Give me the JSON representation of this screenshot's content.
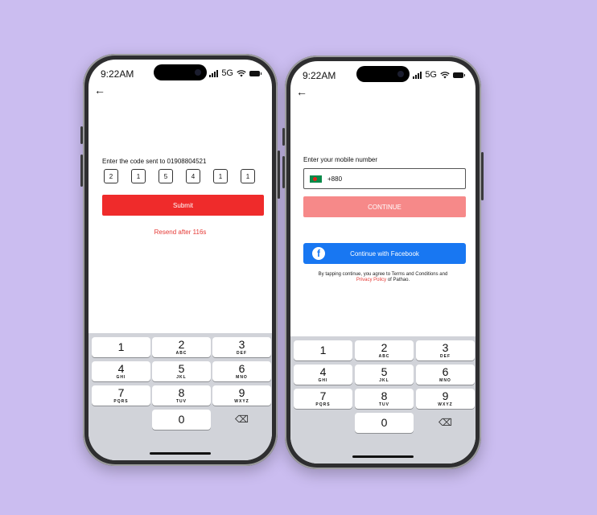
{
  "colors": {
    "background": "#cbbdf0",
    "submit_button": "#ef2b2b",
    "continue_button": "#f68989",
    "facebook_button": "#1877f2",
    "link_red": "#e53935"
  },
  "keyboard": {
    "keys": [
      {
        "digit": "1",
        "letters": ""
      },
      {
        "digit": "2",
        "letters": "ABC"
      },
      {
        "digit": "3",
        "letters": "DEF"
      },
      {
        "digit": "4",
        "letters": "GHI"
      },
      {
        "digit": "5",
        "letters": "JKL"
      },
      {
        "digit": "6",
        "letters": "MNO"
      },
      {
        "digit": "7",
        "letters": "PQRS"
      },
      {
        "digit": "8",
        "letters": "TUV"
      },
      {
        "digit": "9",
        "letters": "WXYZ"
      },
      {
        "digit": "0",
        "letters": ""
      }
    ],
    "delete_icon": "backspace-icon"
  },
  "otp_screen": {
    "status": {
      "time": "9:22AM",
      "network": "5G"
    },
    "back_icon": "arrow-left-icon",
    "prompt": "Enter the code sent to 01908804521",
    "otp_digits": [
      "2",
      "1",
      "5",
      "4",
      "1",
      "1"
    ],
    "submit_label": "Submit",
    "resend_text": "Resend after 116s"
  },
  "phone_screen": {
    "status": {
      "time": "9:22AM",
      "network": "5G"
    },
    "back_icon": "arrow-left-icon",
    "prompt": "Enter your mobile number",
    "country_flag": "bangladesh-flag-icon",
    "country_code": "+880",
    "continue_label": "CONTINUE",
    "facebook_icon": "facebook-icon",
    "facebook_label": "Continue with Facebook",
    "terms": {
      "prefix": "By tapping continue, you agree to Terms and Conditions and",
      "link": "Privacy Policy",
      "suffix": " of Pathao."
    }
  }
}
